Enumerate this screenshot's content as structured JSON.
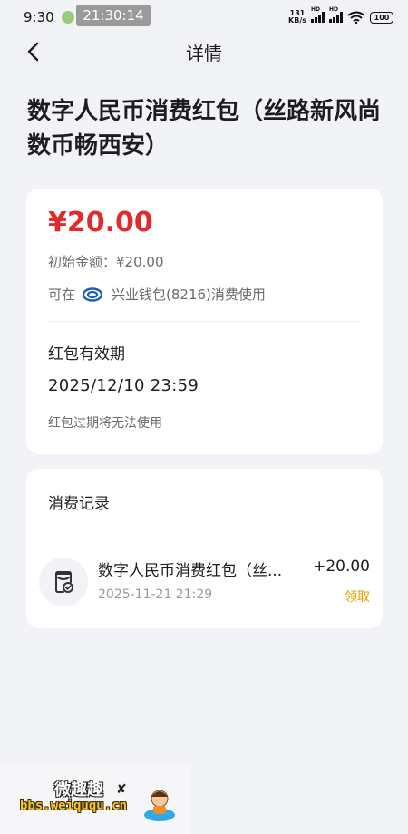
{
  "status_bar": {
    "time": "9:30",
    "dots": "••",
    "overlay_time": "21:30:14",
    "net_speed_value": "131",
    "net_speed_unit": "KB/s",
    "battery": "100"
  },
  "nav": {
    "title": "详情",
    "back_icon": "chevron-left-icon"
  },
  "page": {
    "title": "数字人民币消费红包（丝路新风尚 数币畅西安）"
  },
  "red_packet": {
    "amount": "¥20.00",
    "initial_amount": "初始金额：¥20.00",
    "usable_prefix": "可在",
    "wallet_icon": "industrial-bank-logo-icon",
    "wallet_text": "兴业钱包(8216)消费使用",
    "validity_label": "红包有效期",
    "validity_date": "2025/12/10 23:59",
    "validity_note": "红包过期将无法使用"
  },
  "records": {
    "title": "消费记录",
    "items": [
      {
        "icon": "red-packet-check-icon",
        "name": "数字人民币消费红包（丝...",
        "amount": "+20.00",
        "time": "2025-11-21 21:29",
        "status": "领取"
      }
    ]
  },
  "watermark": {
    "cn": "微趣趣",
    "url": "bbs.weiququ.cn",
    "mark": "✘"
  },
  "colors": {
    "amount_red": "#e4292b",
    "status_orange": "#e6a100",
    "background": "#f2f3f7"
  }
}
